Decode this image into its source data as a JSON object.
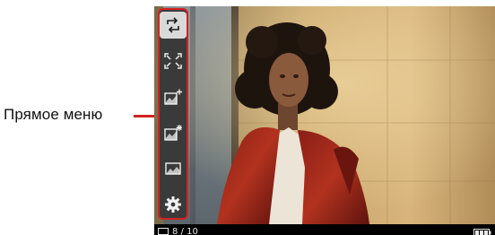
{
  "annotation": {
    "label": "Прямое меню"
  },
  "menu": {
    "items": [
      {
        "icon": "rotate-image-icon",
        "active": true
      },
      {
        "icon": "fit-to-screen-icon",
        "active": false
      },
      {
        "icon": "brightness-up-icon",
        "active": false
      },
      {
        "icon": "brightness-auto-icon",
        "active": false
      },
      {
        "icon": "image-info-icon",
        "active": false
      },
      {
        "icon": "settings-gear-icon",
        "active": false
      }
    ]
  },
  "status": {
    "counter": "8 / 10",
    "counter_icon": "display-icon",
    "battery_icon": "battery-icon"
  },
  "colors": {
    "annotation_red": "#d32222",
    "menu_bg": "#3a3a3a",
    "active_item_bg": "#d9d9d9"
  }
}
